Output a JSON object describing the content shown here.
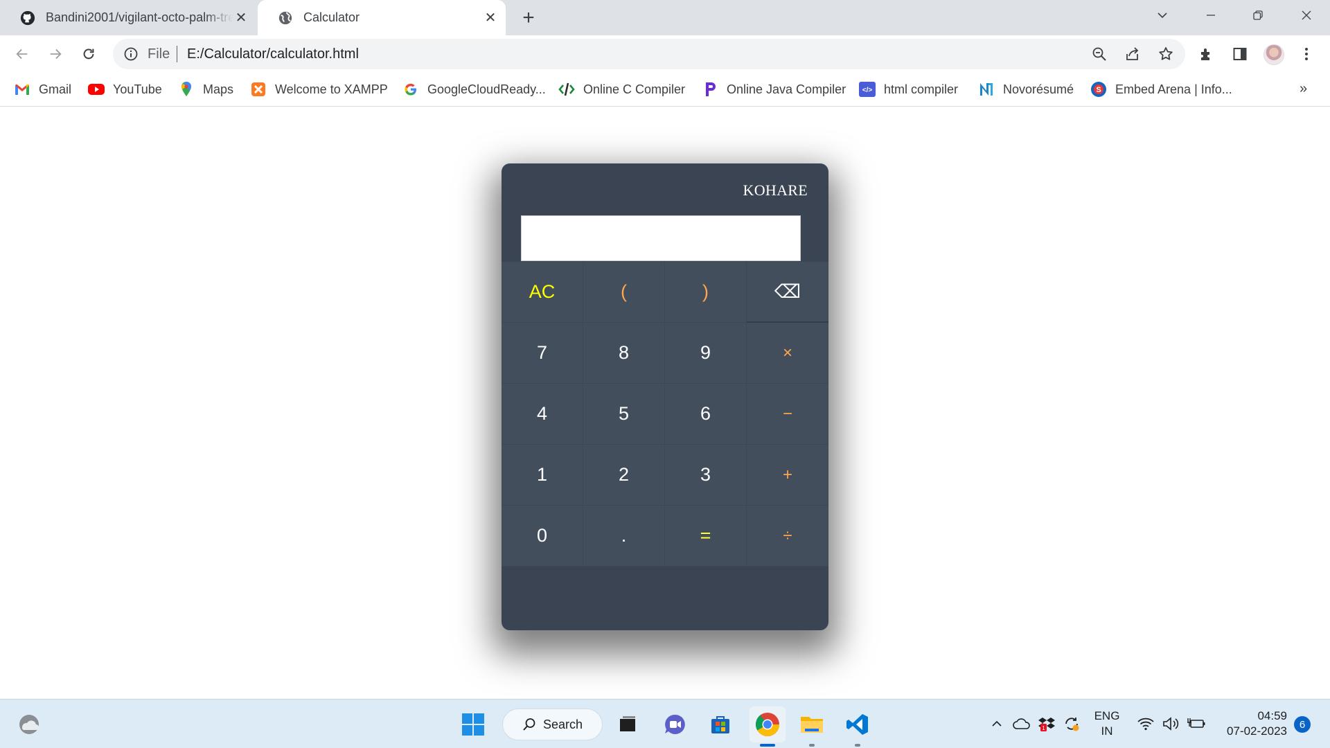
{
  "browser": {
    "tabs": [
      {
        "title": "Bandini2001/vigilant-octo-palm-tree",
        "favicon": "github-icon",
        "active": false
      },
      {
        "title": "Calculator",
        "favicon": "globe-icon",
        "active": true
      }
    ],
    "close_glyph": "✕",
    "new_tab_glyph": "+",
    "address": {
      "scheme_label": "File",
      "url": "E:/Calculator/calculator.html"
    },
    "bookmarks": [
      {
        "label": "Gmail",
        "icon": "gmail-icon",
        "color": "#ea4335"
      },
      {
        "label": "YouTube",
        "icon": "youtube-icon",
        "color": "#ff0000"
      },
      {
        "label": "Maps",
        "icon": "maps-icon",
        "color": "#34a853"
      },
      {
        "label": "Welcome to XAMPP",
        "icon": "xampp-icon",
        "color": "#fb7a24"
      },
      {
        "label": "GoogleCloudReady...",
        "icon": "google-icon",
        "color": "#4285f4"
      },
      {
        "label": "Online C Compiler",
        "icon": "code-icon",
        "color": "#1a8a3a"
      },
      {
        "label": "Online Java Compiler",
        "icon": "programiz-icon",
        "color": "#6c2bd9"
      },
      {
        "label": "html compiler",
        "icon": "html-icon",
        "color": "#4a5cd8"
      },
      {
        "label": "Novorésumé",
        "icon": "novoresume-icon",
        "color": "#1d86c8"
      },
      {
        "label": "Embed Arena | Info...",
        "icon": "embed-arena-icon",
        "color": "#1565c0"
      }
    ],
    "bookmarks_overflow": "»"
  },
  "calculator": {
    "brand": "KOHARE",
    "display_value": "",
    "keys": [
      {
        "label": "AC",
        "name": "all-clear-button",
        "kind": "ac"
      },
      {
        "label": "(",
        "name": "open-paren-button",
        "kind": "paren"
      },
      {
        "label": ")",
        "name": "close-paren-button",
        "kind": "paren"
      },
      {
        "label": "⌫",
        "name": "backspace-button",
        "kind": "bs"
      },
      {
        "label": "7",
        "name": "digit-7-button",
        "kind": "num"
      },
      {
        "label": "8",
        "name": "digit-8-button",
        "kind": "num"
      },
      {
        "label": "9",
        "name": "digit-9-button",
        "kind": "num"
      },
      {
        "label": "×",
        "name": "multiply-button",
        "kind": "op"
      },
      {
        "label": "4",
        "name": "digit-4-button",
        "kind": "num"
      },
      {
        "label": "5",
        "name": "digit-5-button",
        "kind": "num"
      },
      {
        "label": "6",
        "name": "digit-6-button",
        "kind": "num"
      },
      {
        "label": "−",
        "name": "subtract-button",
        "kind": "op"
      },
      {
        "label": "1",
        "name": "digit-1-button",
        "kind": "num"
      },
      {
        "label": "2",
        "name": "digit-2-button",
        "kind": "num"
      },
      {
        "label": "3",
        "name": "digit-3-button",
        "kind": "num"
      },
      {
        "label": "+",
        "name": "add-button",
        "kind": "op"
      },
      {
        "label": "0",
        "name": "digit-0-button",
        "kind": "num"
      },
      {
        "label": ".",
        "name": "decimal-button",
        "kind": "num"
      },
      {
        "label": "=",
        "name": "equals-button",
        "kind": "eq"
      },
      {
        "label": "÷",
        "name": "divide-button",
        "kind": "op"
      }
    ]
  },
  "taskbar": {
    "search_label": "Search",
    "language": {
      "line1": "ENG",
      "line2": "IN"
    },
    "clock": {
      "time": "04:59",
      "date": "07-02-2023"
    },
    "notification_count": "6"
  },
  "colors": {
    "calc_body": "#3a4452",
    "calc_key": "#434e5d",
    "accent_yellow": "#ffff00",
    "accent_orange": "#ffa64d"
  }
}
